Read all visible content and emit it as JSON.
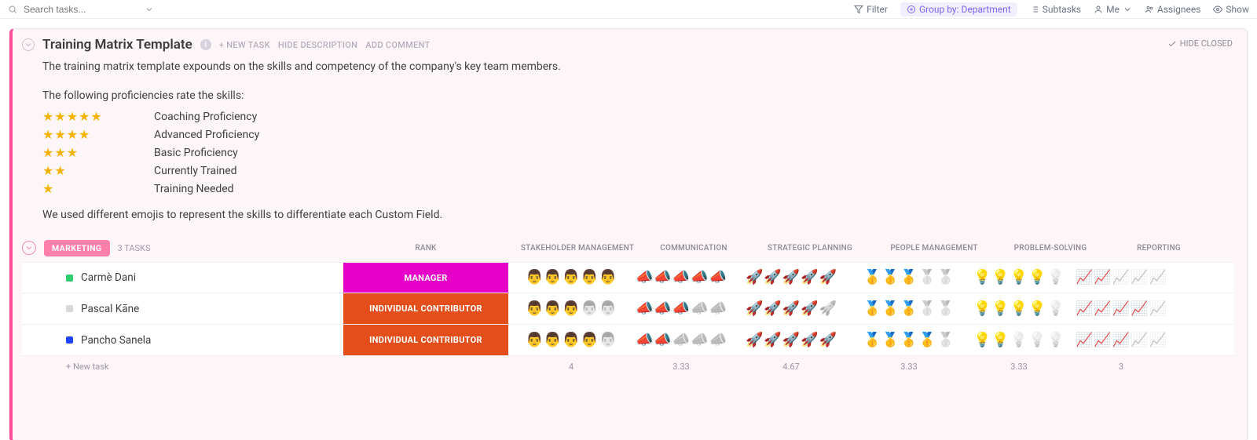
{
  "toolbar": {
    "search_placeholder": "Search tasks...",
    "filter": "Filter",
    "group_by": "Group by: Department",
    "subtasks": "Subtasks",
    "me": "Me",
    "assignees": "Assignees",
    "show": "Show"
  },
  "panel": {
    "title": "Training Matrix Template",
    "new_task": "+ NEW TASK",
    "hide_description": "HIDE DESCRIPTION",
    "add_comment": "ADD COMMENT",
    "hide_closed": "HIDE CLOSED",
    "description": "The training matrix template expounds on the skills and competency of the company's key team members.",
    "prof_intro": "The following proficiencies rate the skills:",
    "proficiencies": [
      {
        "stars": 5,
        "label": "Coaching Proficiency"
      },
      {
        "stars": 4,
        "label": "Advanced Proficiency"
      },
      {
        "stars": 3,
        "label": "Basic Proficiency"
      },
      {
        "stars": 2,
        "label": "Currently Trained"
      },
      {
        "stars": 1,
        "label": "Training Needed"
      }
    ],
    "emoji_note": "We used different emojis to represent the skills to differentiate each Custom Field."
  },
  "group": {
    "name": "MARKETING",
    "count": "3 TASKS",
    "columns": {
      "rank": "RANK",
      "stakeholder": "STAKEHOLDER MANAGEMENT",
      "communication": "COMMUNICATION",
      "strategic": "STRATEGIC PLANNING",
      "people": "PEOPLE MANAGEMENT",
      "problem": "PROBLEM-SOLVING",
      "reporting": "REPORTING"
    }
  },
  "tasks": [
    {
      "name": "Carmè Dani",
      "status_class": "sq-green",
      "rank": "MANAGER",
      "rank_class": "rank-manager",
      "skills": {
        "stakeholder": 5,
        "communication": 5,
        "strategic": 5,
        "people": 3,
        "problem": 4,
        "reporting": 2
      }
    },
    {
      "name": "Pascal Kāne",
      "status_class": "sq-grey",
      "rank": "INDIVIDUAL CONTRIBUTOR",
      "rank_class": "rank-ic",
      "skills": {
        "stakeholder": 3,
        "communication": 3,
        "strategic": 4,
        "people": 3,
        "problem": 4,
        "reporting": 4
      }
    },
    {
      "name": "Pancho Sanela",
      "status_class": "sq-blue",
      "rank": "INDIVIDUAL CONTRIBUTOR",
      "rank_class": "rank-ic",
      "skills": {
        "stakeholder": 4,
        "communication": 2,
        "strategic": 5,
        "people": 4,
        "problem": 2,
        "reporting": 3
      }
    }
  ],
  "averages": {
    "stakeholder": "4",
    "communication": "3.33",
    "strategic": "4.67",
    "people": "3.33",
    "problem": "3.33",
    "reporting": "3"
  },
  "footer_new_task": "+ New task",
  "emoji_map": {
    "stakeholder": "👨",
    "communication": "📣",
    "strategic": "🚀",
    "people": "🥇",
    "problem": "💡",
    "reporting": "📈"
  }
}
